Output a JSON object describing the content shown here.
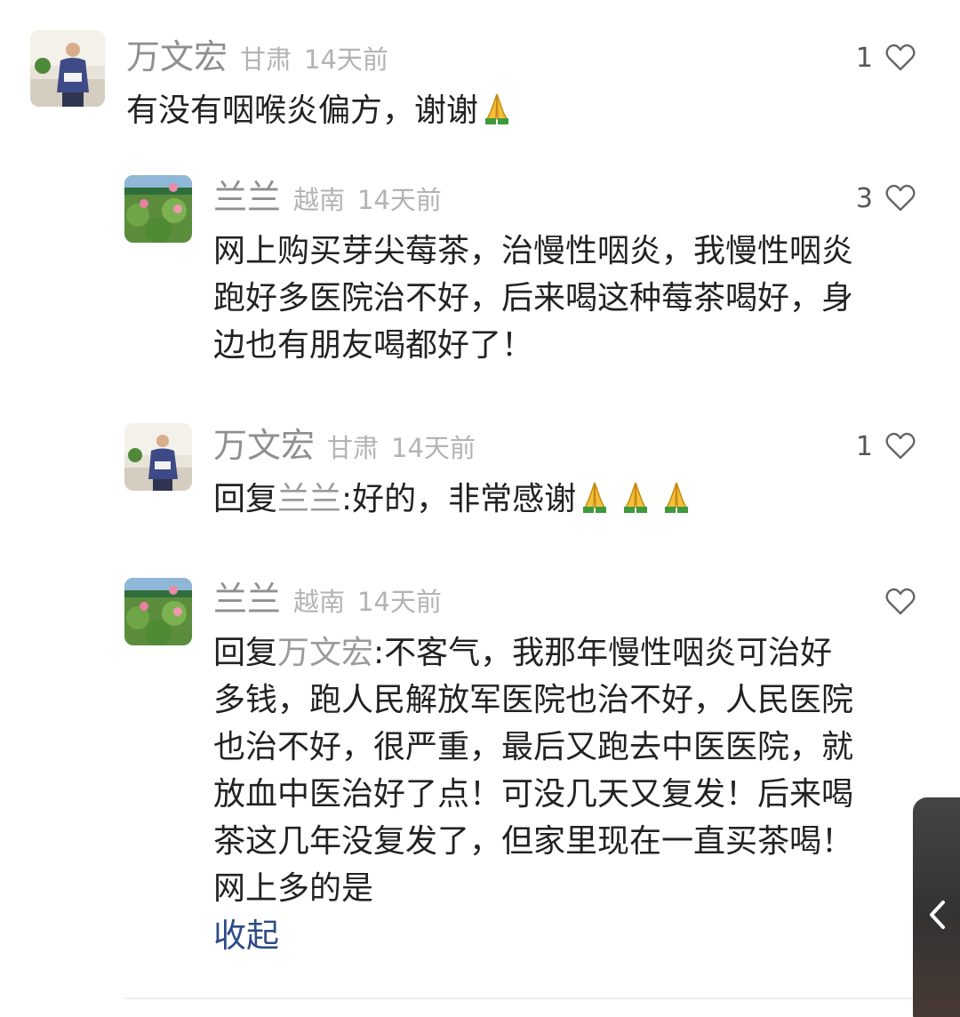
{
  "comments": [
    {
      "user": "万文宏",
      "location": "甘肃",
      "time": "14天前",
      "likes": "1",
      "text": "有没有咽喉炎偏方，谢谢",
      "emoji_count": 1,
      "emoji": "🙏"
    },
    {
      "user": "兰兰",
      "location": "越南",
      "time": "14天前",
      "likes": "3",
      "lines": [
        "网上购买芽尖莓茶，治慢性咽炎，我慢性咽炎",
        "跑好多医院治不好，后来喝这种莓茶喝好，身",
        "边也有朋友喝都好了！"
      ]
    },
    {
      "user": "万文宏",
      "location": "甘肃",
      "time": "14天前",
      "likes": "1",
      "reply_prefix": "回复",
      "reply_to": "兰兰",
      "text": ":好的，非常感谢",
      "emoji_count": 3
    },
    {
      "user": "兰兰",
      "location": "越南",
      "time": "14天前",
      "likes": "",
      "reply_prefix": "回复",
      "reply_to": "万文宏",
      "first_line": ":不客气，我那年慢性咽炎可治好",
      "lines": [
        "多钱，跑人民解放军医院也治不好，人民医院",
        "也治不好，很严重，最后又跑去中医医院，就",
        "放血中医治好了点！可没几天又复发！后来喝",
        "茶这几年没复发了，但家里现在一直买茶喝！",
        "网上多的是"
      ],
      "collapse_label": "收起"
    }
  ],
  "colors": {
    "name": "#8f8f8f",
    "meta": "#b3b3b3",
    "text": "#222222",
    "link": "#2c4b86"
  },
  "icons": {
    "like": "heart-outline-icon",
    "side": "chevron-left-icon"
  }
}
